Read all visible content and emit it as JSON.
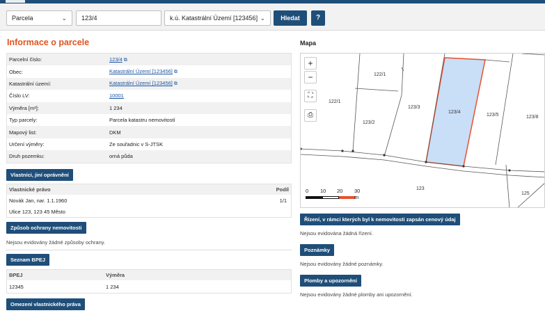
{
  "colors": {
    "brand": "#1f4e79",
    "section_title": "#e0531f",
    "link": "#1a55a3",
    "parcel_fill": "#c9def7",
    "parcel_outline": "#e8502d"
  },
  "search": {
    "type_value": "Parcela",
    "number_value": "123/4",
    "cadastre_value": "k.ú. Katastrální Území [123456]",
    "search_button": "Hledat",
    "help_button": "?"
  },
  "parcel": {
    "title": "Informace o parcele",
    "rows": [
      {
        "label": "Parcelní číslo:",
        "value": "123/4"
      },
      {
        "label": "Obec:",
        "value": "Katastrální Území [123456]"
      },
      {
        "label": "Katastrální území:",
        "value": "Katastrální Území [123456]"
      },
      {
        "label": "Číslo LV:",
        "value": "10001"
      },
      {
        "label": "Výměra [m²]:",
        "value": "1 234"
      },
      {
        "label": "Typ parcely:",
        "value": "Parcela katastru nemovitostí"
      },
      {
        "label": "Mapový list:",
        "value": "DKM"
      },
      {
        "label": "Určení výměry:",
        "value": "Ze souřadnic v S-JTSK"
      },
      {
        "label": "Druh pozemku:",
        "value": "orná půda"
      }
    ]
  },
  "owners": {
    "button": "Vlastníci, jiní oprávnění",
    "header_left": "Vlastnické právo",
    "header_right": "Podíl",
    "name": "Novák Jan, nar. 1.1.1960",
    "share": "1/1",
    "address": "Ulice 123, 123 45 Město"
  },
  "protection": {
    "button": "Způsob ochrany nemovitosti",
    "note": "Nejsou evidovány žádné způsoby ochrany."
  },
  "bpej": {
    "button": "Seznam BPEJ",
    "col1": "BPEJ",
    "col2": "Výměra",
    "code": "12345",
    "area": "1 234"
  },
  "restriction": {
    "button": "Omezení vlastnického práva"
  },
  "map": {
    "title": "Mapa",
    "zoom_in": "+",
    "zoom_out": "−",
    "labels": [
      "122/1",
      "122/1",
      "123/3",
      "123/4",
      "123/5",
      "123/8",
      "123/2",
      "123",
      "125"
    ],
    "scale": [
      "0",
      "10",
      "20",
      "30 m"
    ]
  },
  "proceedings": {
    "button": "Řízení, v rámci kterých byl k nemovitosti zapsán cenový údaj",
    "note": "Nejsou evidována žádná řízení."
  },
  "notes_section": {
    "button": "Poznámky",
    "note": "Nejsou evidovány žádné poznámky."
  },
  "seals": {
    "button": "Plomby a upozornění",
    "note": "Nejsou evidovány žádné plomby ani upozornění."
  }
}
